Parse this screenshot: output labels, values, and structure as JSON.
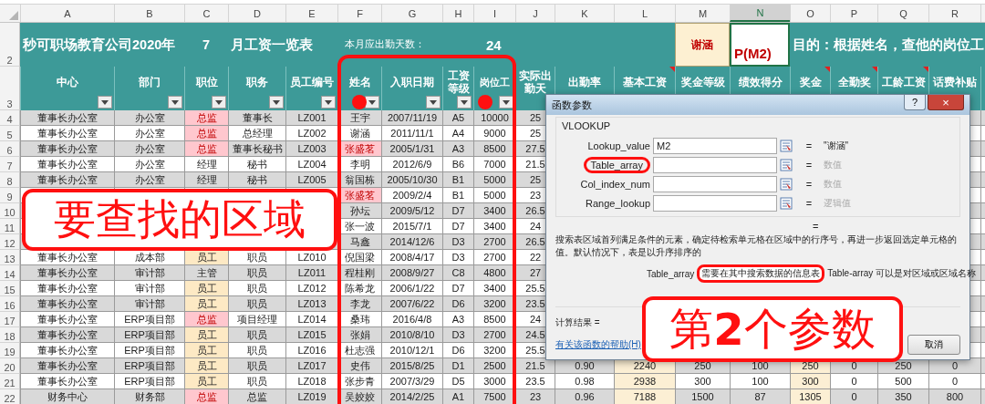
{
  "sheet": {
    "columns": [
      {
        "label": "A",
        "selected": false
      },
      {
        "label": "B",
        "selected": false
      },
      {
        "label": "C",
        "selected": false
      },
      {
        "label": "D",
        "selected": false
      },
      {
        "label": "E",
        "selected": false
      },
      {
        "label": "F",
        "selected": false
      },
      {
        "label": "G",
        "selected": false
      },
      {
        "label": "H",
        "selected": false
      },
      {
        "label": "I",
        "selected": false
      },
      {
        "label": "J",
        "selected": false
      },
      {
        "label": "K",
        "selected": false
      },
      {
        "label": "L",
        "selected": false
      },
      {
        "label": "M",
        "selected": false
      },
      {
        "label": "N",
        "selected": true
      },
      {
        "label": "O",
        "selected": false
      },
      {
        "label": "P",
        "selected": false
      },
      {
        "label": "Q",
        "selected": false
      },
      {
        "label": "R",
        "selected": false
      }
    ],
    "title_row": {
      "number": "2",
      "title": "秒可职场教育公司2020年",
      "month": "7",
      "title_suffix": "月工资一览表",
      "days_label": "本月应出勤天数：",
      "days": "24",
      "lookup_name": "谢涵",
      "formula": "P(M2)",
      "purpose": "目的：根据姓名，查他的岗位工"
    },
    "header_row": {
      "number": "3",
      "headers": [
        {
          "label": "中心",
          "filter": true,
          "comment": false
        },
        {
          "label": "部门",
          "filter": true,
          "comment": false
        },
        {
          "label": "职位",
          "filter": true,
          "comment": false
        },
        {
          "label": "职务",
          "filter": true,
          "comment": false
        },
        {
          "label": "员工编号",
          "filter": true,
          "comment": false
        },
        {
          "label": "姓名",
          "filter": true,
          "comment": false
        },
        {
          "label": "入职日期",
          "filter": true,
          "comment": false
        },
        {
          "label": "工资等级",
          "filter": true,
          "comment": false
        },
        {
          "label": "岗位工",
          "filter": true,
          "comment": false
        },
        {
          "label": "实际出勤天",
          "filter": false,
          "comment": false
        },
        {
          "label": "出勤率",
          "filter": false,
          "comment": false
        },
        {
          "label": "基本工资",
          "filter": false,
          "comment": true
        },
        {
          "label": "奖金等级",
          "filter": false,
          "comment": false
        },
        {
          "label": "绩效得分",
          "filter": false,
          "comment": false
        },
        {
          "label": "奖金",
          "filter": false,
          "comment": true
        },
        {
          "label": "全勤奖",
          "filter": false,
          "comment": true
        },
        {
          "label": "工龄工资",
          "filter": false,
          "comment": true
        },
        {
          "label": "话费补贴",
          "filter": false,
          "comment": false
        }
      ]
    },
    "rows": [
      {
        "number": "4",
        "color": "#ffc7ce",
        "name_duplicate": false,
        "cells": [
          "董事长办公室",
          "办公室",
          "总监",
          "董事长",
          "LZ001",
          "王宇",
          "2007/11/19",
          "A5",
          "10000",
          "25"
        ]
      },
      {
        "number": "5",
        "color": "#ffc7ce",
        "name_duplicate": false,
        "cells": [
          "董事长办公室",
          "办公室",
          "总监",
          "总经理",
          "LZ002",
          "谢涵",
          "2011/11/1",
          "A4",
          "9000",
          "25"
        ]
      },
      {
        "number": "6",
        "color": "#ffc7ce",
        "name_duplicate": true,
        "cells": [
          "董事长办公室",
          "办公室",
          "总监",
          "董事长秘书",
          "LZ003",
          "张盛茗",
          "2005/1/31",
          "A3",
          "8500",
          "27.5"
        ]
      },
      {
        "number": "7",
        "name_duplicate": false,
        "cells": [
          "董事长办公室",
          "办公室",
          "经理",
          "秘书",
          "LZ004",
          "李明",
          "2012/6/9",
          "B6",
          "7000",
          "21.5"
        ]
      },
      {
        "number": "8",
        "name_duplicate": false,
        "cells": [
          "董事长办公室",
          "办公室",
          "经理",
          "秘书",
          "LZ005",
          "翁国栋",
          "2005/10/30",
          "B1",
          "5000",
          "25"
        ]
      },
      {
        "number": "9",
        "name_duplicate": true,
        "cells": [
          null,
          null,
          null,
          null,
          null,
          "张盛茗",
          "2009/2/4",
          "B1",
          "5000",
          "23"
        ]
      },
      {
        "number": "10",
        "name_duplicate": false,
        "cells": [
          null,
          null,
          null,
          null,
          null,
          "孙坛",
          "2009/5/12",
          "D7",
          "3400",
          "26.5"
        ]
      },
      {
        "number": "11",
        "name_duplicate": false,
        "cells": [
          null,
          null,
          null,
          null,
          null,
          "张一波",
          "2015/7/1",
          "D7",
          "3400",
          "24"
        ]
      },
      {
        "number": "12",
        "name_duplicate": false,
        "cells": [
          null,
          null,
          null,
          null,
          null,
          "马鑫",
          "2014/12/6",
          "D3",
          "2700",
          "26.5"
        ]
      },
      {
        "number": "13",
        "color": "#fde9c4",
        "name_duplicate": false,
        "cells": [
          "董事长办公室",
          "成本部",
          "员工",
          "职员",
          "LZ010",
          "倪国梁",
          "2008/4/17",
          "D3",
          "2700",
          "22"
        ]
      },
      {
        "number": "14",
        "name_duplicate": false,
        "cells": [
          "董事长办公室",
          "审计部",
          "主管",
          "职员",
          "LZ011",
          "程桂刚",
          "2008/9/27",
          "C8",
          "4800",
          "27"
        ]
      },
      {
        "number": "15",
        "color": "#fde9c4",
        "name_duplicate": false,
        "cells": [
          "董事长办公室",
          "审计部",
          "员工",
          "职员",
          "LZ012",
          "陈希龙",
          "2006/1/22",
          "D7",
          "3400",
          "25.5"
        ]
      },
      {
        "number": "16",
        "color": "#fde9c4",
        "name_duplicate": false,
        "cells": [
          "董事长办公室",
          "审计部",
          "员工",
          "职员",
          "LZ013",
          "李龙",
          "2007/6/22",
          "D6",
          "3200",
          "23.5"
        ]
      },
      {
        "number": "17",
        "color": "#ffc7ce",
        "name_duplicate": false,
        "cells": [
          "董事长办公室",
          "ERP项目部",
          "总监",
          "项目经理",
          "LZ014",
          "桑玮",
          "2016/4/8",
          "A3",
          "8500",
          "24"
        ]
      },
      {
        "number": "18",
        "color": "#fde9c4",
        "name_duplicate": false,
        "cells": [
          "董事长办公室",
          "ERP项目部",
          "员工",
          "职员",
          "LZ015",
          "张娟",
          "2010/8/10",
          "D3",
          "2700",
          "24.5"
        ]
      },
      {
        "number": "19",
        "color": "#fde9c4",
        "name_duplicate": false,
        "cells": [
          "董事长办公室",
          "ERP项目部",
          "员工",
          "职员",
          "LZ016",
          "杜志强",
          "2010/12/1",
          "D6",
          "3200",
          "25.5"
        ]
      },
      {
        "number": "20",
        "color": "#fde9c4",
        "name_duplicate": false,
        "cells": [
          "董事长办公室",
          "ERP项目部",
          "员工",
          "职员",
          "LZ017",
          "史伟",
          "2015/8/25",
          "D1",
          "2500",
          "21.5",
          "0.90",
          "2240",
          "250",
          "100",
          "250",
          "0",
          "250",
          "0"
        ]
      },
      {
        "number": "21",
        "color": "#fde9c4",
        "name_duplicate": false,
        "cells": [
          "董事长办公室",
          "ERP项目部",
          "员工",
          "职员",
          "LZ018",
          "张步青",
          "2007/3/29",
          "D5",
          "3000",
          "23.5",
          "0.98",
          "2938",
          "300",
          "100",
          "300",
          "0",
          "500",
          "0"
        ]
      },
      {
        "number": "22",
        "color": "#ffc7ce",
        "name_duplicate": false,
        "cells": [
          "财务中心",
          "财务部",
          "总监",
          "总监",
          "LZ019",
          "吴姣姣",
          "2014/2/25",
          "A1",
          "7500",
          "23",
          "0.96",
          "7188",
          "1500",
          "87",
          "1305",
          "0",
          "350",
          "800"
        ]
      }
    ]
  },
  "dialog": {
    "title": "函数参数",
    "help_button": "?",
    "close_button": "×",
    "function": "VLOOKUP",
    "args": [
      {
        "label": "Lookup_value",
        "value": "M2",
        "equals": "=",
        "result": "\"谢涵\"",
        "resolved": true,
        "circled": false
      },
      {
        "label": "Table_array",
        "equals": "=",
        "result": "数值",
        "resolved": false,
        "circled": true
      },
      {
        "label": "Col_index_num",
        "equals": "=",
        "result": "数值",
        "resolved": false,
        "circled": false
      },
      {
        "label": "Range_lookup",
        "equals": "=",
        "result": "逻辑值",
        "resolved": false,
        "circled": false
      }
    ],
    "formula_equals": "=",
    "description": "搜索表区域首列满足条件的元素，确定待检索单元格在区域中的行序号，再进一步返回选定单元格的值。默认情况下，表是以升序排序的",
    "param_name": "Table_array",
    "param_highlight": "需要在其中搜索数据的信息表",
    "param_rest": "Table-array 可以是对区域或区域名称",
    "result_label": "计算结果 =",
    "help_link": "有关该函数的帮助(H)",
    "cancel": "取消"
  },
  "annotations": {
    "callouts": [
      "要查找的区域",
      "第**2**个参数"
    ]
  }
}
